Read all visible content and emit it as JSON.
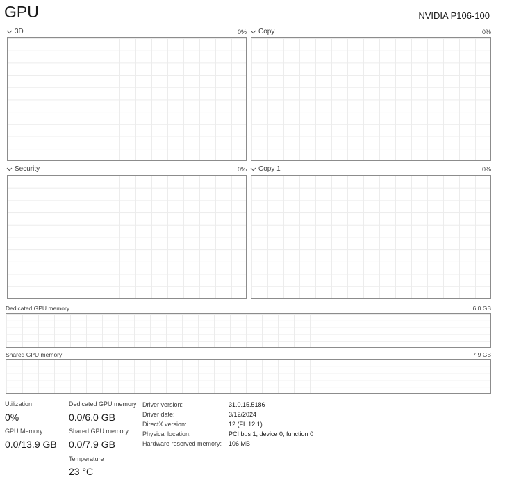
{
  "header": {
    "title": "GPU",
    "device": "NVIDIA P106-100"
  },
  "engines": [
    {
      "name": "3D",
      "percent": "0%"
    },
    {
      "name": "Copy",
      "percent": "0%"
    },
    {
      "name": "Security",
      "percent": "0%"
    },
    {
      "name": "Copy 1",
      "percent": "0%"
    }
  ],
  "memory_graphs": {
    "dedicated": {
      "label": "Dedicated GPU memory",
      "max": "6.0 GB"
    },
    "shared": {
      "label": "Shared GPU memory",
      "max": "7.9 GB"
    }
  },
  "stats": {
    "utilization": {
      "label": "Utilization",
      "value": "0%"
    },
    "gpu_memory": {
      "label": "GPU Memory",
      "value": "0.0/13.9 GB"
    },
    "dedicated": {
      "label": "Dedicated GPU memory",
      "value": "0.0/6.0 GB"
    },
    "shared": {
      "label": "Shared GPU memory",
      "value": "0.0/7.9 GB"
    },
    "temperature": {
      "label": "Temperature",
      "value": "23 °C"
    }
  },
  "info": {
    "driver_version": {
      "key": "Driver version:",
      "value": "31.0.15.5186"
    },
    "driver_date": {
      "key": "Driver date:",
      "value": "3/12/2024"
    },
    "directx": {
      "key": "DirectX version:",
      "value": "12 (FL 12.1)"
    },
    "location": {
      "key": "Physical location:",
      "value": "PCI bus 1, device 0, function 0"
    },
    "reserved": {
      "key": "Hardware reserved memory:",
      "value": "106 MB"
    }
  },
  "icons": {
    "chevron": "chevron-down-icon"
  }
}
